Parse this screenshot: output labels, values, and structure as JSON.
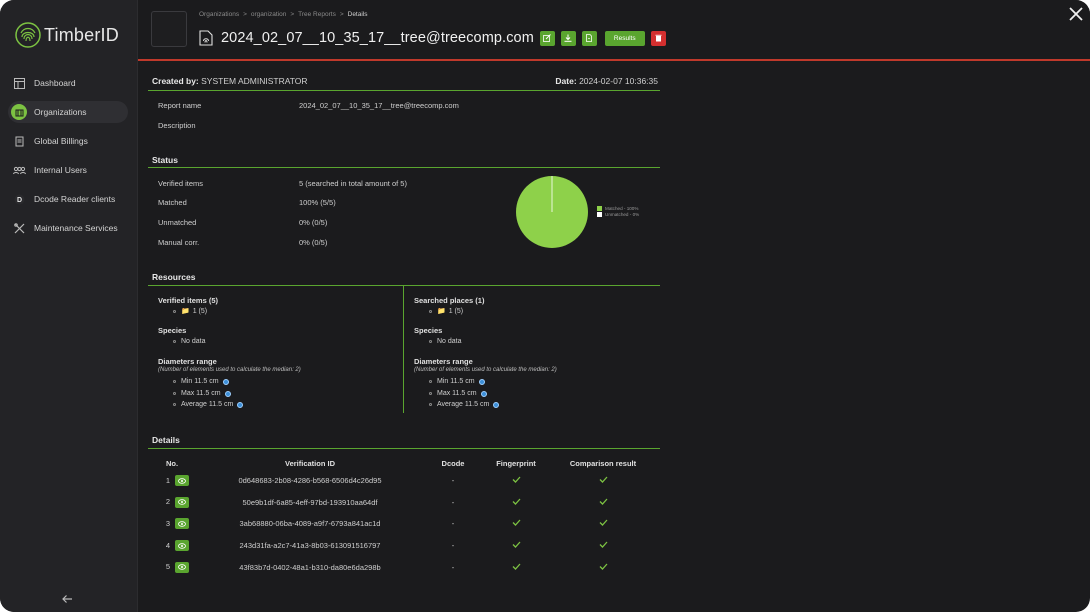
{
  "app": {
    "logo_text": "TimberID"
  },
  "sidebar": {
    "items": [
      {
        "label": "Dashboard",
        "icon": "dashboard-icon"
      },
      {
        "label": "Organizations",
        "icon": "organizations-icon",
        "active": true
      },
      {
        "label": "Global Billings",
        "icon": "billings-icon"
      },
      {
        "label": "Internal Users",
        "icon": "users-icon"
      },
      {
        "label": "Dcode Reader clients",
        "icon": "dcode-reader-icon"
      },
      {
        "label": "Maintenance Services",
        "icon": "maintenance-icon"
      }
    ]
  },
  "breadcrumb": [
    "Organizations",
    "organization",
    "Tree Reports",
    "Details"
  ],
  "header": {
    "title": "2024_02_07__10_35_17__tree@treecomp.com",
    "results_label": "Results"
  },
  "report": {
    "created_by_label": "Created by:",
    "created_by": "SYSTEM ADMINISTRATOR",
    "date_label": "Date:",
    "date": "2024-02-07 10:36:35",
    "report_name_label": "Report name",
    "report_name": "2024_02_07__10_35_17__tree@treecomp.com",
    "description_label": "Description",
    "description": ""
  },
  "status": {
    "title": "Status",
    "rows": [
      {
        "label": "Verified items",
        "value": "5 (searched in total amount of 5)"
      },
      {
        "label": "Matched",
        "value": "100% (5/5)"
      },
      {
        "label": "Unmatched",
        "value": "0% (0/5)"
      },
      {
        "label": "Manual corr.",
        "value": "0% (0/5)"
      }
    ],
    "pie": {
      "matched_pct": 100,
      "legend": [
        "Matched - 100%",
        "Unmatched - 0%"
      ],
      "colors": {
        "matched": "#8ed14a",
        "unmatched": "#ffffff"
      }
    }
  },
  "resources": {
    "title": "Resources",
    "left": {
      "items_title": "Verified items (5)",
      "items_value": "1 (5)",
      "species_title": "Species",
      "species_value": "No data",
      "diam_title": "Diameters range",
      "diam_note": "(Number of elements used to calculate the median: 2)",
      "min": "Min 11.5 cm",
      "max": "Max 11.5 cm",
      "avg": "Average 11.5 cm"
    },
    "right": {
      "items_title": "Searched places (1)",
      "items_value": "1 (5)",
      "species_title": "Species",
      "species_value": "No data",
      "diam_title": "Diameters range",
      "diam_note": "(Number of elements used to calculate the median: 2)",
      "min": "Min 11.5 cm",
      "max": "Max 11.5 cm",
      "avg": "Average 11.5 cm"
    }
  },
  "details": {
    "title": "Details",
    "columns": [
      "No.",
      "Verification ID",
      "Dcode",
      "Fingerprint",
      "Comparison result"
    ],
    "rows": [
      {
        "no": "1",
        "id": "0d648683-2b08-4286-b568-6506d4c26d95",
        "dcode": "-"
      },
      {
        "no": "2",
        "id": "50e9b1df-6a85-4eff-97bd-193910aa64df",
        "dcode": "-"
      },
      {
        "no": "3",
        "id": "3ab68880-06ba-4089-a9f7-6793a841ac1d",
        "dcode": "-"
      },
      {
        "no": "4",
        "id": "243d31fa-a2c7-41a3-8b03-613091516797",
        "dcode": "-"
      },
      {
        "no": "5",
        "id": "43f83b7d-0402-48a1-b310-da80e6da298b",
        "dcode": "-"
      }
    ]
  },
  "colors": {
    "accent": "#5aa52f",
    "danger": "#d42f2f",
    "bg": "#1b1b1d"
  }
}
